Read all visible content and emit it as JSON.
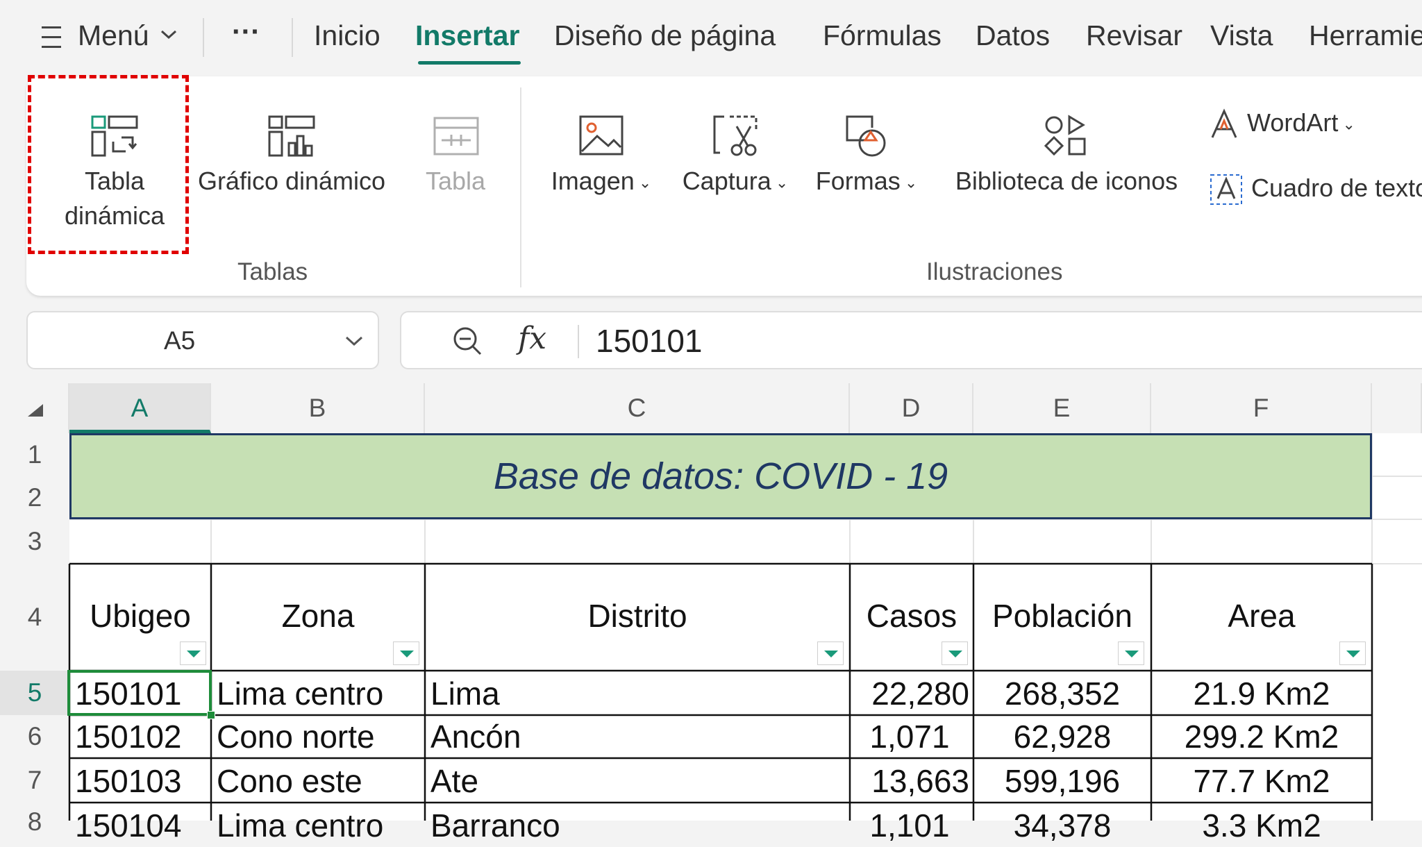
{
  "menubar": {
    "menu_label": "Menú",
    "more": "···",
    "tabs": [
      "Inicio",
      "Insertar",
      "Diseño de página",
      "Fórmulas",
      "Datos",
      "Revisar",
      "Vista",
      "Herramientas"
    ],
    "active_tab": "Insertar"
  },
  "ribbon": {
    "tablas": {
      "pivot_table_line1": "Tabla",
      "pivot_table_line2": "dinámica",
      "pivot_chart": "Gráfico dinámico",
      "table": "Tabla",
      "group_label": "Tablas"
    },
    "ilustraciones": {
      "image": "Imagen",
      "capture": "Captura",
      "shapes": "Formas",
      "icon_library": "Biblioteca de iconos",
      "wordart": "WordArt",
      "textbox": "Cuadro de texto",
      "group_label": "Ilustraciones"
    }
  },
  "formula_bar": {
    "cell_ref": "A5",
    "fx": "fx",
    "value": "150101"
  },
  "sheet": {
    "columns": [
      "A",
      "B",
      "C",
      "D",
      "E",
      "F"
    ],
    "selected_column": "A",
    "rows": [
      "1",
      "2",
      "3",
      "4",
      "5",
      "6",
      "7",
      "8"
    ],
    "selected_row": "5",
    "title": "Base de datos: COVID - 19",
    "headers": [
      "Ubigeo",
      "Zona",
      "Distrito",
      "Casos",
      "Población",
      "Area"
    ],
    "data": [
      [
        "150101",
        "Lima centro",
        "Lima",
        "22,280",
        "268,352",
        "21.9 Km2"
      ],
      [
        "150102",
        "Cono norte",
        "Ancón",
        "1,071",
        "62,928",
        "299.2 Km2"
      ],
      [
        "150103",
        "Cono este",
        "Ate",
        "13,663",
        "599,196",
        "77.7 Km2"
      ],
      [
        "150104",
        "Lima centro",
        "Barranco",
        "1,101",
        "34,378",
        "3.3 Km2"
      ]
    ]
  },
  "colors": {
    "accent": "#127a68",
    "title_fill": "#c6e0b4",
    "title_text": "#1f3864",
    "highlight": "#e00000"
  }
}
